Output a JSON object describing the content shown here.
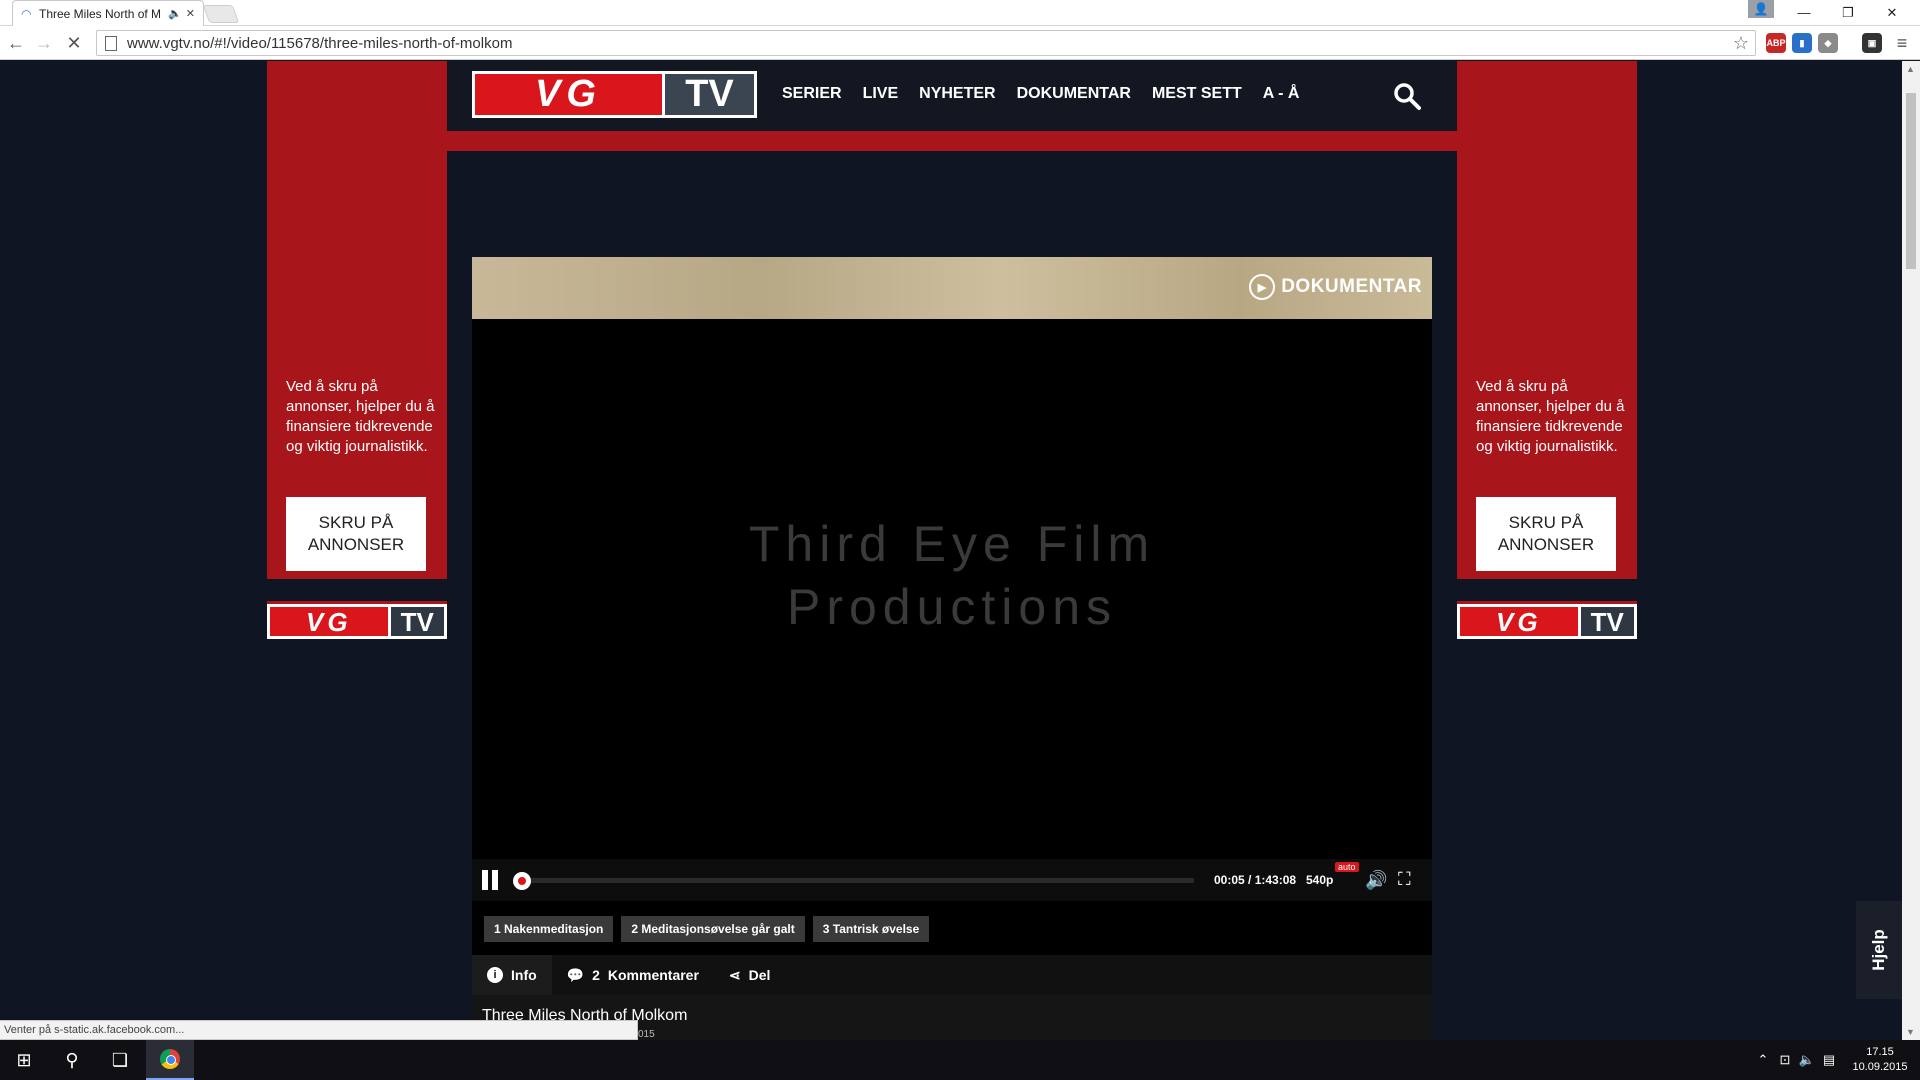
{
  "browser": {
    "tab_title": "Three Miles North of M",
    "url": "www.vgtv.no/#!/video/115678/three-miles-north-of-molkom",
    "status_text": "Venter på s-static.ak.facebook.com..."
  },
  "site": {
    "logo_vg": "VG",
    "logo_tv": "TV",
    "nav": [
      "SERIER",
      "LIVE",
      "NYHETER",
      "DOKUMENTAR",
      "MEST SETT",
      "A - Å"
    ]
  },
  "side_ad": {
    "text": "Ved å skru på annonser, hjelper du å finansiere tidkrevende og viktig journalistikk.",
    "button_label": "SKRU PÅ ANNONSER"
  },
  "player": {
    "banner_label": "DOKUMENTAR",
    "video_title_line1": "Third Eye Film",
    "video_title_line2": "Productions",
    "time": "00:05 / 1:43:08",
    "quality": "540p",
    "quality_badge": "auto"
  },
  "chapters": [
    "1 Nakenmeditasjon",
    "2 Meditasjonsøvelse går galt",
    "3 Tantrisk øvelse"
  ],
  "info_tabs": {
    "info": "Info",
    "comments_count": "2",
    "comments": "Kommentarer",
    "share": "Del"
  },
  "video_info": {
    "title": "Three Miles North of Molkom",
    "date_fragment": "015"
  },
  "help_label": "Hjelp",
  "taskbar": {
    "time": "17.15",
    "date": "10.09.2015"
  },
  "colors": {
    "vg_red": "#d9161c",
    "ad_red": "#a8151a",
    "page_bg": "#0f1522"
  }
}
